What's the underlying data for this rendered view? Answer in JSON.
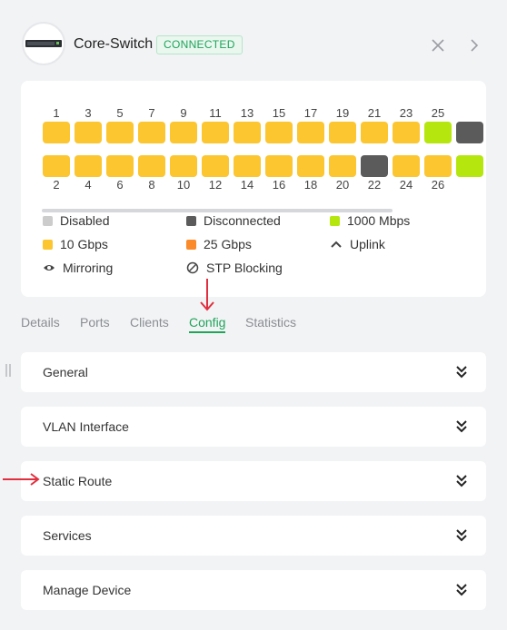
{
  "device": {
    "name": "Core-Switch",
    "status": "CONNECTED"
  },
  "ports": {
    "top": [
      {
        "label": "1",
        "state": "10g"
      },
      {
        "label": "3",
        "state": "10g"
      },
      {
        "label": "5",
        "state": "10g"
      },
      {
        "label": "7",
        "state": "10g"
      },
      {
        "label": "9",
        "state": "10g"
      },
      {
        "label": "11",
        "state": "10g"
      },
      {
        "label": "13",
        "state": "10g"
      },
      {
        "label": "15",
        "state": "10g"
      },
      {
        "label": "17",
        "state": "10g"
      },
      {
        "label": "19",
        "state": "10g"
      },
      {
        "label": "21",
        "state": "10g"
      },
      {
        "label": "23",
        "state": "10g"
      },
      {
        "label": "25",
        "state": "1000"
      }
    ],
    "bottom": [
      {
        "label": "2",
        "state": "10g"
      },
      {
        "label": "4",
        "state": "10g"
      },
      {
        "label": "6",
        "state": "10g"
      },
      {
        "label": "8",
        "state": "10g"
      },
      {
        "label": "10",
        "state": "10g"
      },
      {
        "label": "12",
        "state": "10g"
      },
      {
        "label": "14",
        "state": "10g"
      },
      {
        "label": "16",
        "state": "10g"
      },
      {
        "label": "18",
        "state": "10g"
      },
      {
        "label": "20",
        "state": "10g"
      },
      {
        "label": "22",
        "state": "disconnected"
      },
      {
        "label": "24",
        "state": "10g"
      },
      {
        "label": "26",
        "state": "10g"
      }
    ]
  },
  "legend": {
    "disabled": "Disabled",
    "disconnected": "Disconnected",
    "g1000": "1000 Mbps",
    "g10": "10 Gbps",
    "g25": "25 Gbps",
    "uplink": "Uplink",
    "mirroring": "Mirroring",
    "stp": "STP Blocking"
  },
  "colors": {
    "disabled": "#cccccc",
    "disconnected": "#5b5b5b",
    "g1000": "#b5e70f",
    "g10": "#fcc631",
    "g25": "#fa8a2a",
    "accent": "#1fa55a",
    "annotation": "#e0303f"
  },
  "tabs": [
    {
      "label": "Details"
    },
    {
      "label": "Ports"
    },
    {
      "label": "Clients"
    },
    {
      "label": "Config"
    },
    {
      "label": "Statistics"
    }
  ],
  "sections": [
    {
      "label": "General"
    },
    {
      "label": "VLAN Interface"
    },
    {
      "label": "Static Route"
    },
    {
      "label": "Services"
    },
    {
      "label": "Manage Device"
    }
  ]
}
